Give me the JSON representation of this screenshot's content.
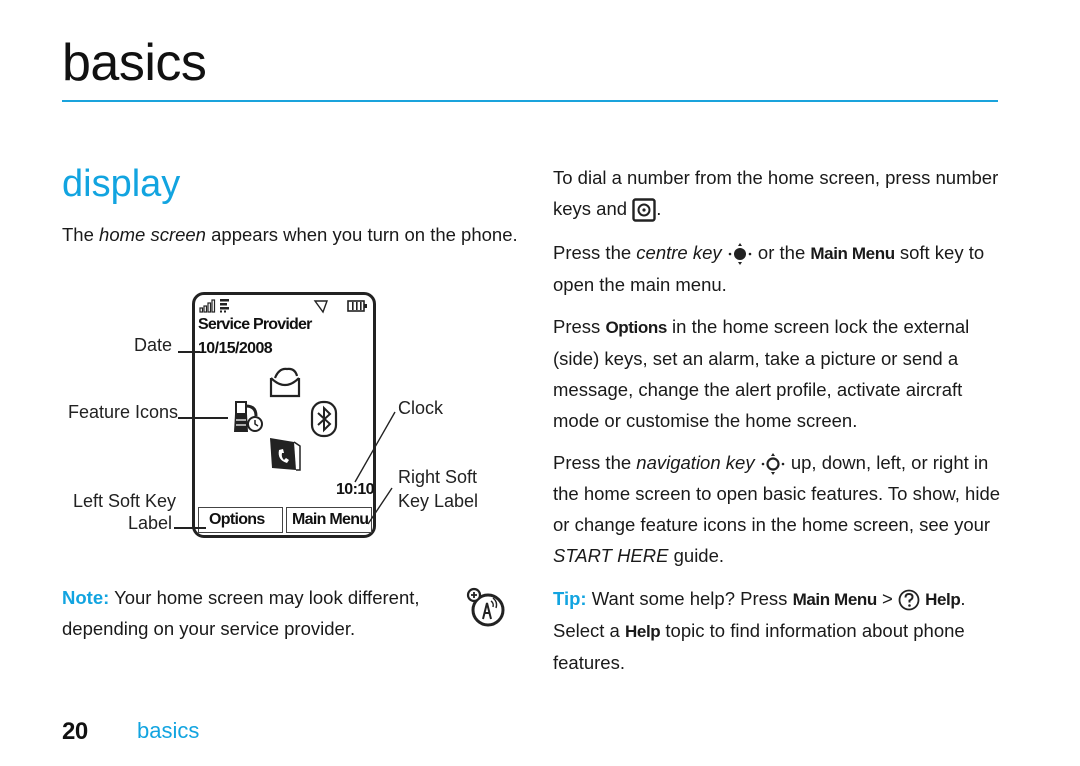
{
  "header": {
    "chapter_title": "basics",
    "accent_color": "#12a4e0"
  },
  "section": {
    "title": "display",
    "intro": {
      "before": "The ",
      "emphasis": "home screen",
      "after": " appears when you turn on the phone."
    }
  },
  "phone_diagram": {
    "status_icons": [
      "signal-strength-icon",
      "data-connection-icon",
      "alert-profile-icon",
      "battery-icon"
    ],
    "service_provider": "Service Provider",
    "date": "10/15/2008",
    "feature_icons": [
      "messages-icon",
      "recent-calls-icon",
      "bluetooth-icon",
      "phonebook-icon"
    ],
    "clock": "10:10",
    "left_soft_key": "Options",
    "right_soft_key": "Main Menu",
    "callouts": {
      "date": "Date",
      "feature_icons": "Feature Icons",
      "left_soft_key_line1": "Left Soft Key",
      "left_soft_key_line2": "Label",
      "clock": "Clock",
      "right_soft_key_line1": "Right Soft",
      "right_soft_key_line2": "Key Label"
    }
  },
  "note": {
    "label": "Note:",
    "text": " Your home screen may look different, depending on your service provider.",
    "icon": "network-dependent-feature-icon"
  },
  "right_column": {
    "p1": {
      "text_before": "To dial a number from the home screen, press number keys and ",
      "key_icon": "send-key-icon",
      "text_after": "."
    },
    "p2": {
      "text_before": "Press the ",
      "emphasis": "centre key",
      "key_icon": "centre-key-icon",
      "text_mid": " or the ",
      "bold": "Main Menu",
      "text_after": " soft key to open the main menu."
    },
    "p3": {
      "text_before": "Press ",
      "bold": "Options",
      "text_after": " in the home screen lock the external (side) keys, set an alarm, take a picture or send a message, change the alert profile, activate aircraft mode or customise the home screen."
    },
    "p4": {
      "text_before": "Press the ",
      "emphasis": "navigation key",
      "key_icon": "navigation-key-icon",
      "text_mid": " up, down, left, or right in the home screen to open basic features. To show, hide or change feature icons in the home screen, see your ",
      "emphasis2": "START HERE",
      "text_after": " guide."
    },
    "tip": {
      "label": "Tip:",
      "text1": " Want some help? Press ",
      "bold1": "Main Menu",
      "sep": " > ",
      "help_icon": "help-icon",
      "bold2": "Help",
      "text2": ". Select a ",
      "bold3": "Help",
      "text3": " topic to find information about phone features."
    }
  },
  "footer": {
    "page_number": "20",
    "chapter": "basics"
  }
}
